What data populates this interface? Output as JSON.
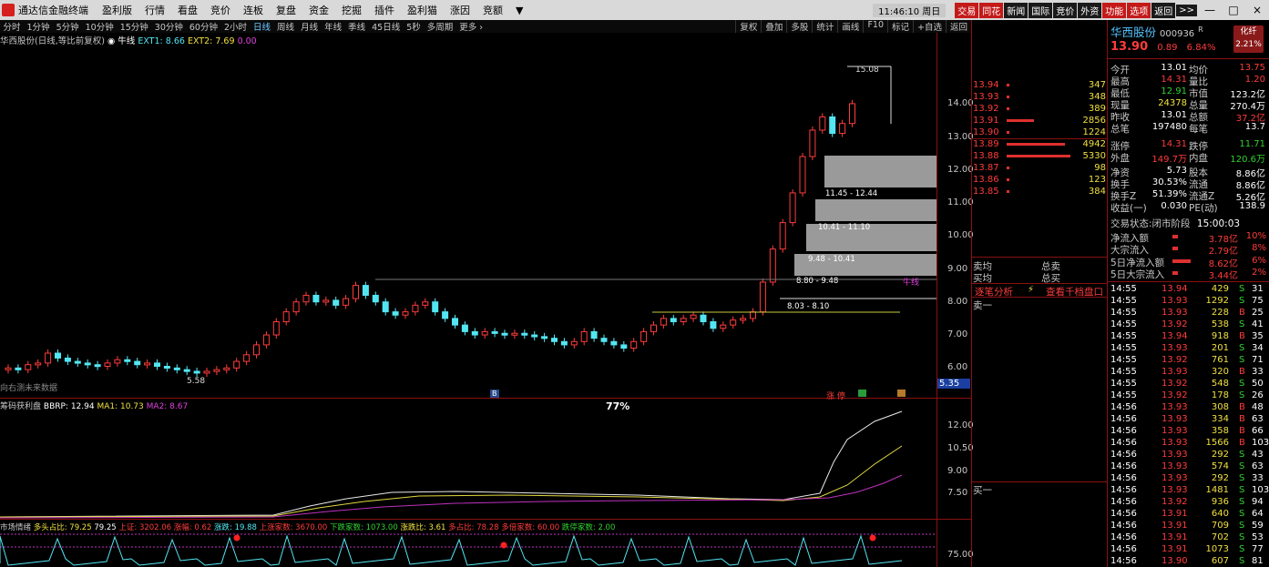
{
  "app": {
    "title": "通达信金融终端",
    "menus": [
      "盈利版",
      "行情",
      "看盘",
      "竞价",
      "连板",
      "复盘",
      "资金",
      "挖掘",
      "插件",
      "盈利猫",
      "涨因",
      "竞额",
      "▼"
    ],
    "clock": "11:46:10 周日",
    "right_buttons": [
      "交易",
      "同花",
      "新闻",
      "国际",
      "竞价",
      "外资",
      "功能",
      "选项",
      "返回",
      ">>"
    ],
    "win": [
      "—",
      "□",
      "×"
    ]
  },
  "periods": [
    "分时",
    "1分钟",
    "5分钟",
    "10分钟",
    "15分钟",
    "30分钟",
    "60分钟",
    "2小时",
    "日线",
    "周线",
    "月线",
    "年线",
    "季线",
    "45日线",
    "5秒",
    "多周期",
    "更多 ›"
  ],
  "active_period": "日线",
  "tools": [
    "复权",
    "叠加",
    "多股",
    "统计",
    "画线",
    "F10",
    "标记",
    "+自选",
    "返回"
  ],
  "chart_head": {
    "name": "华西股份(日线,等比前复权)",
    "mark": "◉",
    "ind": "牛线",
    "ext1": "EXT1: 8.66",
    "ext2": "EXT2: 7.69",
    "z": "0.00"
  },
  "price_axis": [
    "14.00",
    "13.00",
    "12.00",
    "11.00",
    "10.00",
    "9.00",
    "8.00",
    "7.00",
    "6.00"
  ],
  "price_tag": "5.35",
  "annotations": {
    "peak": "15.08",
    "low": "5.58",
    "future": "向右测未来数据",
    "niuxian": "牛线",
    "b_marker": "B",
    "zt": "涨 停",
    "pct": "77%"
  },
  "price_boxes": [
    "11.45 - 12.44",
    "10.41 - 11.10",
    "9.48 - 10.41",
    "8.80 - 9.48",
    "8.03 - 8.10"
  ],
  "ind1": {
    "label": "筹码获利盘",
    "brp": "BBRP: 12.94",
    "ma1": "MA1: 10.73",
    "ma2": "MA2: 8.67",
    "axis": [
      "12.00",
      "10.50",
      "9.00",
      "7.50"
    ]
  },
  "ind2": {
    "label": "市场情绪",
    "items": [
      "多头占比: 79.25",
      "79.25",
      "上证: 3202.06",
      "涨幅: 0.62",
      "涨跌: 19.88",
      "上涨家数: 3670.00",
      "下跌家数: 1073.00",
      "涨跌比: 3.61",
      "多占比: 78.28",
      "多倍家数: 60.00",
      "跌停家数: 2.00"
    ],
    "axis": "75.00"
  },
  "quote": {
    "name": "华西股份",
    "code": "000936",
    "flag": "R",
    "price": "13.90",
    "chg": "0.89",
    "pct": "6.84%",
    "chip_label": "化纤",
    "chip_pct": "2.21%"
  },
  "orderbook": {
    "asks": [
      [
        "13.94",
        "347"
      ],
      [
        "13.93",
        "348"
      ],
      [
        "13.92",
        "389"
      ],
      [
        "13.91",
        "2856"
      ],
      [
        "13.90",
        "1224"
      ]
    ],
    "bids": [
      [
        "13.89",
        "4942"
      ],
      [
        "13.88",
        "5330"
      ],
      [
        "13.87",
        "98"
      ],
      [
        "13.86",
        "123"
      ],
      [
        "13.85",
        "384"
      ]
    ]
  },
  "stats_left": [
    [
      "今开",
      "13.01"
    ],
    [
      "最高",
      "14.31"
    ],
    [
      "最低",
      "12.91"
    ],
    [
      "现量",
      "24378"
    ],
    [
      "昨收",
      "13.01"
    ],
    [
      "总笔",
      "197480"
    ],
    [
      "涨停",
      "14.31"
    ],
    [
      "外盘",
      "149.7万"
    ],
    [
      "净资",
      "5.73"
    ],
    [
      "换手",
      "30.53%"
    ],
    [
      "换手Z",
      "51.39%"
    ],
    [
      "收益(一)",
      "0.030"
    ]
  ],
  "stats_right": [
    [
      "均价",
      "13.75"
    ],
    [
      "量比",
      "1.20"
    ],
    [
      "市值",
      "123.2亿"
    ],
    [
      "总量",
      "270.4万"
    ],
    [
      "总额",
      "37.2亿"
    ],
    [
      "每笔",
      "13.7"
    ],
    [
      "跌停",
      "11.71"
    ],
    [
      "内盘",
      "120.6万"
    ],
    [
      "股本",
      "8.86亿"
    ],
    [
      "流通",
      "8.86亿"
    ],
    [
      "流通Z",
      "5.26亿"
    ],
    [
      "PE(动)",
      "138.9"
    ]
  ],
  "trade_status": {
    "label": "交易状态",
    "value": "闭市阶段",
    "time": "15:00:03"
  },
  "flows": [
    [
      "净流入额",
      "3.78亿",
      "10%"
    ],
    [
      "大宗流入",
      "2.79亿",
      "8%"
    ],
    [
      "5日净流入额",
      "8.62亿",
      "6%"
    ],
    [
      "5日大宗流入",
      "3.44亿",
      "2%"
    ]
  ],
  "mid": {
    "junmai": "卖均",
    "zongmai": "总卖",
    "junbuy": "买均",
    "zongbuy": "总买",
    "tab1": "逐笔分析",
    "tab2": "查看千档盘口",
    "sell1": "卖一",
    "buy1": "买一"
  },
  "ticks": [
    [
      "14:55",
      "13.94",
      "429",
      "S",
      "31"
    ],
    [
      "14:55",
      "13.93",
      "1292",
      "S",
      "75"
    ],
    [
      "14:55",
      "13.93",
      "228",
      "B",
      "25"
    ],
    [
      "14:55",
      "13.92",
      "538",
      "S",
      "41"
    ],
    [
      "14:55",
      "13.94",
      "918",
      "B",
      "35"
    ],
    [
      "14:55",
      "13.93",
      "201",
      "S",
      "34"
    ],
    [
      "14:55",
      "13.92",
      "761",
      "S",
      "71"
    ],
    [
      "14:55",
      "13.93",
      "320",
      "B",
      "33"
    ],
    [
      "14:55",
      "13.92",
      "548",
      "S",
      "50"
    ],
    [
      "14:55",
      "13.92",
      "178",
      "S",
      "26"
    ],
    [
      "14:56",
      "13.93",
      "308",
      "B",
      "48"
    ],
    [
      "14:56",
      "13.93",
      "334",
      "B",
      "63"
    ],
    [
      "14:56",
      "13.93",
      "358",
      "B",
      "66"
    ],
    [
      "14:56",
      "13.93",
      "1566",
      "B",
      "103"
    ],
    [
      "14:56",
      "13.93",
      "292",
      "S",
      "43"
    ],
    [
      "14:56",
      "13.93",
      "574",
      "S",
      "63"
    ],
    [
      "14:56",
      "13.93",
      "292",
      "S",
      "33"
    ],
    [
      "14:56",
      "13.93",
      "1481",
      "S",
      "103"
    ],
    [
      "14:56",
      "13.92",
      "936",
      "S",
      "94"
    ],
    [
      "14:56",
      "13.91",
      "640",
      "S",
      "64"
    ],
    [
      "14:56",
      "13.91",
      "709",
      "S",
      "59"
    ],
    [
      "14:56",
      "13.91",
      "702",
      "S",
      "53"
    ],
    [
      "14:56",
      "13.91",
      "1073",
      "S",
      "77"
    ],
    [
      "14:56",
      "13.90",
      "607",
      "S",
      "81"
    ]
  ]
}
